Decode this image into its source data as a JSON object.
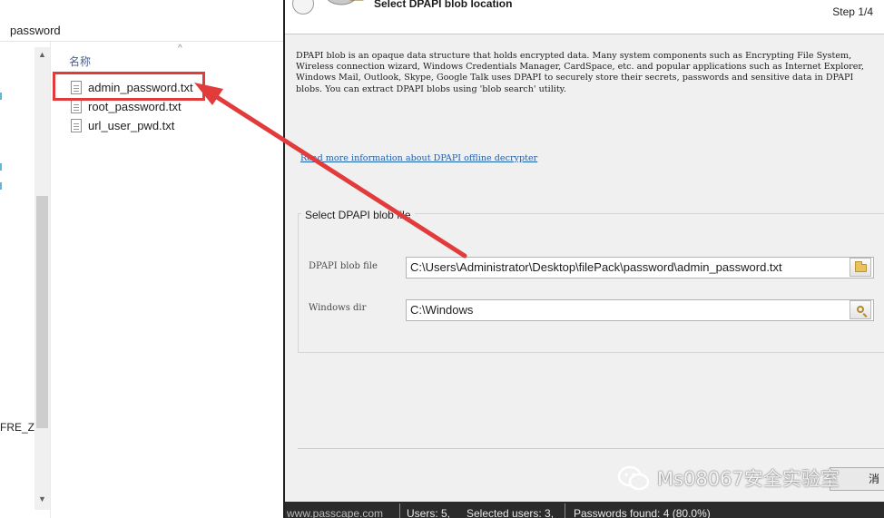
{
  "explorer": {
    "address_path": "password",
    "column_header": "名称",
    "nav_fragment": "FRE_ZH",
    "files": [
      {
        "name": "admin_password.txt",
        "highlighted": true
      },
      {
        "name": "root_password.txt",
        "highlighted": false
      },
      {
        "name": "url_user_pwd.txt",
        "highlighted": false
      }
    ]
  },
  "dialog": {
    "title": "Select DPAPI blob location",
    "step": "Step 1/4",
    "description": "DPAPI blob is an opaque data structure that holds encrypted data. Many system components such as Encrypting File System, Wireless connection wizard, Windows Credentials Manager, CardSpace, etc. and popular applications such as Internet Explorer, Windows Mail, Outlook, Skype, Google Talk uses DPAPI to securely store their secrets, passwords and sensitive data in DPAPI blobs. You can extract DPAPI blobs using 'blob search' utility.",
    "more_info_link": "Read more information about DPAPI offline decrypter",
    "group_title": "Select DPAPI blob file",
    "fields": [
      {
        "label": "DPAPI blob file",
        "value": "C:\\Users\\Administrator\\Desktop\\filePack\\password\\admin_password.txt",
        "button_icon": "folder-open-icon"
      },
      {
        "label": "Windows dir",
        "value": "C:\\Windows",
        "button_icon": "folder-search-icon"
      }
    ],
    "cancel_label": "消"
  },
  "statusbar": {
    "site": "www.passcape.com",
    "users": "Users: 5,",
    "selected_users": "Selected users: 3,",
    "passwords_found": "Passwords found: 4 (80.0%)"
  },
  "watermark": {
    "text": "Ms08067安全实验室"
  },
  "colors": {
    "highlight": "#e23b3b",
    "arrow": "#e23b3b",
    "link": "#1d5faf",
    "dialog_bg": "#f0f0f0",
    "statusbar_bg": "#2b2b2b"
  }
}
